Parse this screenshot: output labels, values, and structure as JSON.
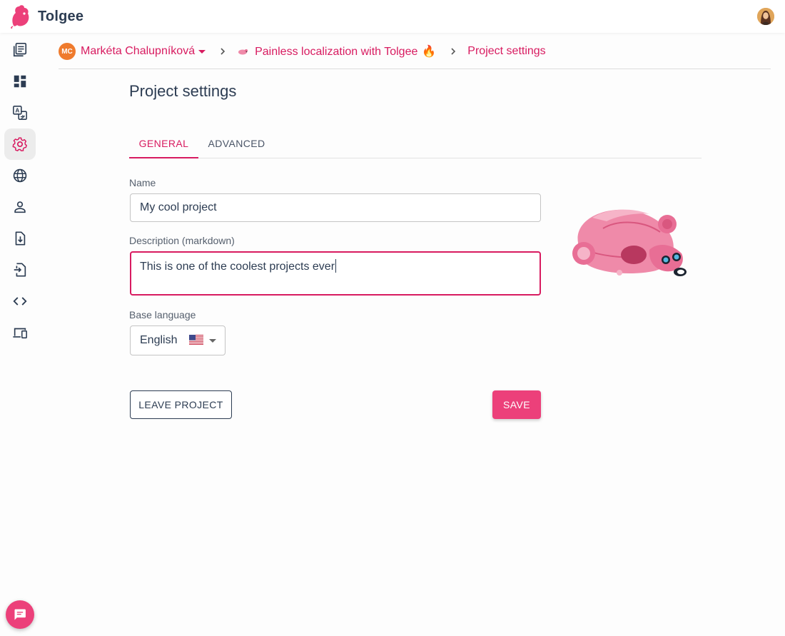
{
  "app": {
    "name": "Tolgee",
    "brand_color": "#ec407a",
    "accent_color": "#d81b60"
  },
  "sidebar": {
    "items": [
      {
        "icon": "translations-list-icon",
        "active": false
      },
      {
        "icon": "dashboard-icon",
        "active": false
      },
      {
        "icon": "languages-icon",
        "active": false
      },
      {
        "icon": "gear-icon",
        "active": true
      },
      {
        "icon": "globe-icon",
        "active": false
      },
      {
        "icon": "person-icon",
        "active": false
      },
      {
        "icon": "file-import-icon",
        "active": false
      },
      {
        "icon": "file-export-icon",
        "active": false
      },
      {
        "icon": "code-icon",
        "active": false
      },
      {
        "icon": "devices-icon",
        "active": false
      }
    ]
  },
  "breadcrumb": {
    "owner_initials": "MC",
    "owner_name": "Markéta Chalupníková",
    "project_name": "Painless localization with Tolgee",
    "project_emoji": "🔥",
    "current": "Project settings"
  },
  "page": {
    "title": "Project settings"
  },
  "tabs": [
    {
      "label": "GENERAL",
      "active": true
    },
    {
      "label": "ADVANCED",
      "active": false
    }
  ],
  "form": {
    "name_label": "Name",
    "name_value": "My cool project",
    "description_label": "Description (markdown)",
    "description_value": "This is one of the coolest projects ever",
    "base_language_label": "Base language",
    "base_language_value": "English"
  },
  "buttons": {
    "leave_label": "LEAVE PROJECT",
    "save_label": "SAVE"
  }
}
